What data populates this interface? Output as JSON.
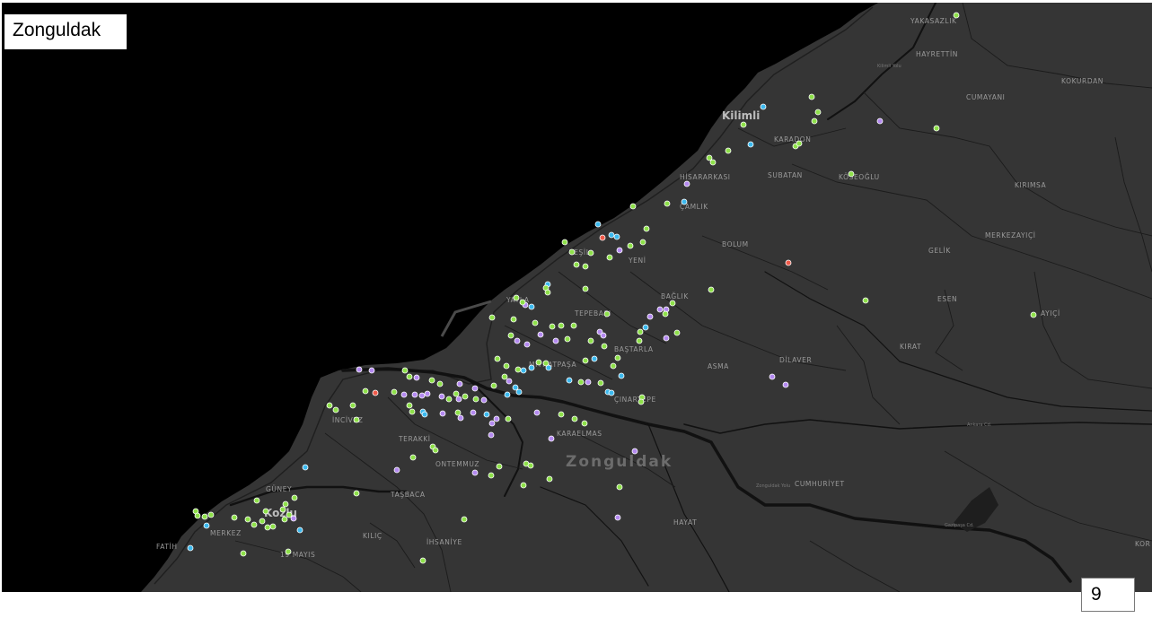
{
  "header": {
    "title": "Zonguldak"
  },
  "footer": {
    "page_number": "9"
  },
  "map": {
    "city_label": "Zonguldak",
    "town_labels": [
      "Kilimli",
      "Kozlu"
    ],
    "place_labels": [
      "YAKASAZLIK",
      "HAYRETTİN",
      "CUMAYANI",
      "KOKURDAN",
      "KARADON",
      "HİSARARKASI",
      "SUBATAN",
      "KÖSEOĞLU",
      "ÇAMLIK",
      "KIRIMSA",
      "BOLUM",
      "GELİK",
      "MERKEZAYIÇİ",
      "YENİ",
      "YEŞİL",
      "BAĞLIK",
      "ESEN",
      "TEPEBAŞI",
      "AYIÇİ",
      "YAYLA",
      "BAŞTARLA",
      "KIRAT",
      "MİTHATPAŞA",
      "ASMA",
      "DİLAVER",
      "ÇINARTEPE",
      "İNCİVEZ",
      "KARAELMAS",
      "TERAKKİ",
      "ONTEMMUZ",
      "CUMHURİYET",
      "GÜNEY",
      "TAŞBACA",
      "HAYAT",
      "MERKEZ",
      "KILIÇ",
      "İHSANİYE",
      "FATİH",
      "19 MAYIS",
      "KOR"
    ],
    "marker_colors": {
      "green": "#8ee04a",
      "purple": "#b48af0",
      "blue": "#3cb9ee",
      "red": "#ef5a4a"
    },
    "land_color": "#353535",
    "sea_color": "#000000"
  }
}
